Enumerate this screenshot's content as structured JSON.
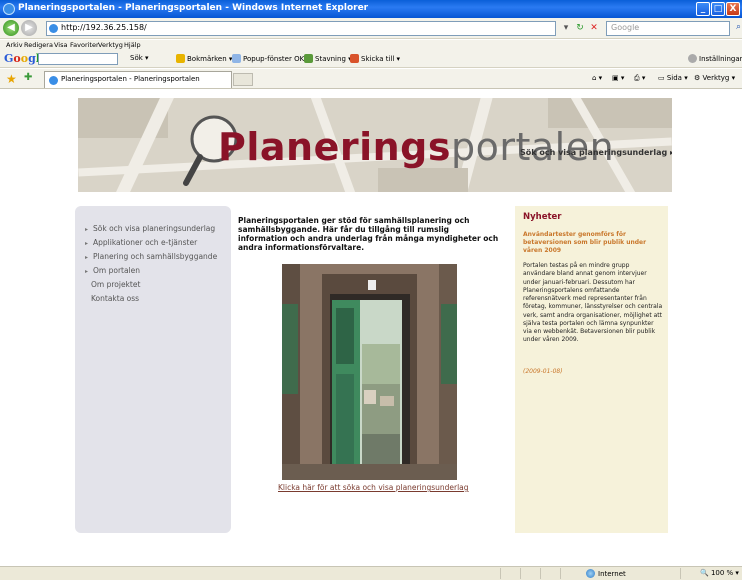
{
  "window": {
    "title": "Planeringsportalen - Planeringsportalen - Windows Internet Explorer",
    "minimize": "_",
    "maximize": "□",
    "close": "X"
  },
  "address_bar": {
    "url": "http://192.36.25.158/",
    "search_placeholder": "Google"
  },
  "menu": [
    "Arkiv",
    "Redigera",
    "Visa",
    "Favoriter",
    "Verktyg",
    "Hjälp"
  ],
  "google_toolbar": {
    "search_label": "Sök",
    "bookmarks": "Bokmärken",
    "popups": "Popup-fönster OK",
    "spelling": "Stavning",
    "send_to": "Skicka till",
    "settings": "Inställningar"
  },
  "tabs": {
    "active_tab": "Planeringsportalen - Planeringsportalen",
    "page_menu": "Sida",
    "tools_menu": "Verktyg"
  },
  "banner": {
    "logo_bold": "Planerings",
    "logo_light": "portalen",
    "link": "Sök och visa planeringsunderlag ▸"
  },
  "left_nav": {
    "items": [
      "Sök och visa planeringsunderlag",
      "Applikationer och e-tjänster",
      "Planering och samhällsbyggande",
      "Om portalen"
    ],
    "subitems": [
      "Om projektet",
      "Kontakta oss"
    ]
  },
  "main": {
    "intro": "Planeringsportalen ger stöd för samhällsplanering och samhällsbyggande. Här får du tillgång till rumslig information och andra underlag från många myndigheter och andra informationsförvaltare.",
    "photo_link": "Klicka här för att söka och visa planeringsunderlag"
  },
  "news": {
    "title": "Nyheter",
    "headline": "Användartester genomförs för betaversionen som blir publik under våren 2009",
    "body": "Portalen testas på en mindre grupp användare bland annat genom intervjuer under januari-februari. Dessutom har Planeringsportalens omfattande referensnätverk med representanter från företag, kommuner, länsstyrelser och centrala verk, samt andra organisationer, möjlighet att själva testa portalen och lämna synpunkter via en webbenkät. Betaversionen blir publik under våren 2009.",
    "date": "(2009-01-08)"
  },
  "status_bar": {
    "zone": "Internet",
    "zoom": "100 %"
  },
  "colors": {
    "brand_red": "#8a1328",
    "news_bg": "#f6f2da",
    "nav_bg": "#e3e3ea",
    "news_accent": "#c9772b"
  }
}
